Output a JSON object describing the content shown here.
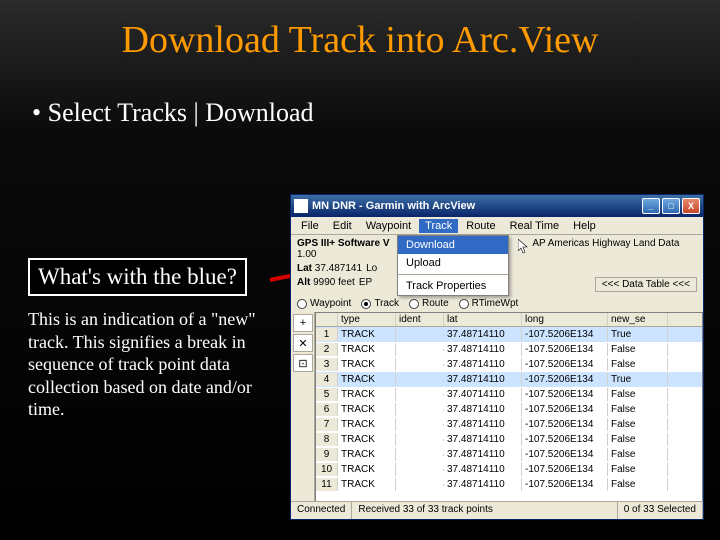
{
  "slide": {
    "title": "Download Track into Arc.View",
    "bullet": "Select Tracks | Download",
    "callout1": "What's with the blue?",
    "callout2": "This is an indication of a \"new\" track.  This signifies a break in sequence of track point data collection based on date and/or time."
  },
  "colors": {
    "title": "#ff9a00"
  },
  "win": {
    "title": "MN DNR - Garmin with ArcView",
    "btns": {
      "min": "_",
      "max": "□",
      "close": "X"
    },
    "menu": [
      "File",
      "Edit",
      "Waypoint",
      "Track",
      "Route",
      "Real Time",
      "Help"
    ],
    "dropdown": [
      "Download",
      "Upload",
      "Track Properties"
    ],
    "info": {
      "gps_label": "GPS III+ Software V",
      "map_label": "AP Americas Highway Land Data 1.00",
      "lat_label": "Lat",
      "lat_val": "37.487141",
      "lon_label": "Lo",
      "alt_label": "Alt",
      "alt_val": "9990 feet",
      "ep_label": "EP"
    },
    "dt_button": "<<< Data Table <<<",
    "radios": [
      "Waypoint",
      "Track",
      "Route",
      "RTimeWpt"
    ],
    "radio_checked": 1,
    "cols": [
      "type",
      "ident",
      "lat",
      "long",
      "new_se"
    ],
    "rows": [
      {
        "n": 1,
        "type": "TRACK",
        "ident": "",
        "lat": "37.48714110",
        "long": "-107.5206E134",
        "new": "True",
        "sel": true
      },
      {
        "n": 2,
        "type": "TRACK",
        "ident": "",
        "lat": "37.48714110",
        "long": "-107.5206E134",
        "new": "False"
      },
      {
        "n": 3,
        "type": "TRACK",
        "ident": "",
        "lat": "37.48714110",
        "long": "-107.5206E134",
        "new": "False"
      },
      {
        "n": 4,
        "type": "TRACK",
        "ident": "",
        "lat": "37.48714110",
        "long": "-107.5206E134",
        "new": "True",
        "sel": true
      },
      {
        "n": 5,
        "type": "TRACK",
        "ident": "",
        "lat": "37.40714110",
        "long": "-107.5206E134",
        "new": "False"
      },
      {
        "n": 6,
        "type": "TRACK",
        "ident": "",
        "lat": "37.48714110",
        "long": "-107.5206E134",
        "new": "False"
      },
      {
        "n": 7,
        "type": "TRACK",
        "ident": "",
        "lat": "37.48714110",
        "long": "-107.5206E134",
        "new": "False"
      },
      {
        "n": 8,
        "type": "TRACK",
        "ident": "",
        "lat": "37.48714110",
        "long": "-107.5206E134",
        "new": "False"
      },
      {
        "n": 9,
        "type": "TRACK",
        "ident": "",
        "lat": "37.48714110",
        "long": "-107.5206E134",
        "new": "False"
      },
      {
        "n": 10,
        "type": "TRACK",
        "ident": "",
        "lat": "37.48714110",
        "long": "-107.5206E134",
        "new": "False"
      },
      {
        "n": 11,
        "type": "TRACK",
        "ident": "",
        "lat": "37.48714110",
        "long": "-107.5206E134",
        "new": "False"
      }
    ],
    "tools": [
      "+",
      "✕",
      "⊡"
    ],
    "status": {
      "conn": "Connected",
      "recv": "Received 33 of 33 track points",
      "sel": "0 of 33 Selected"
    }
  }
}
